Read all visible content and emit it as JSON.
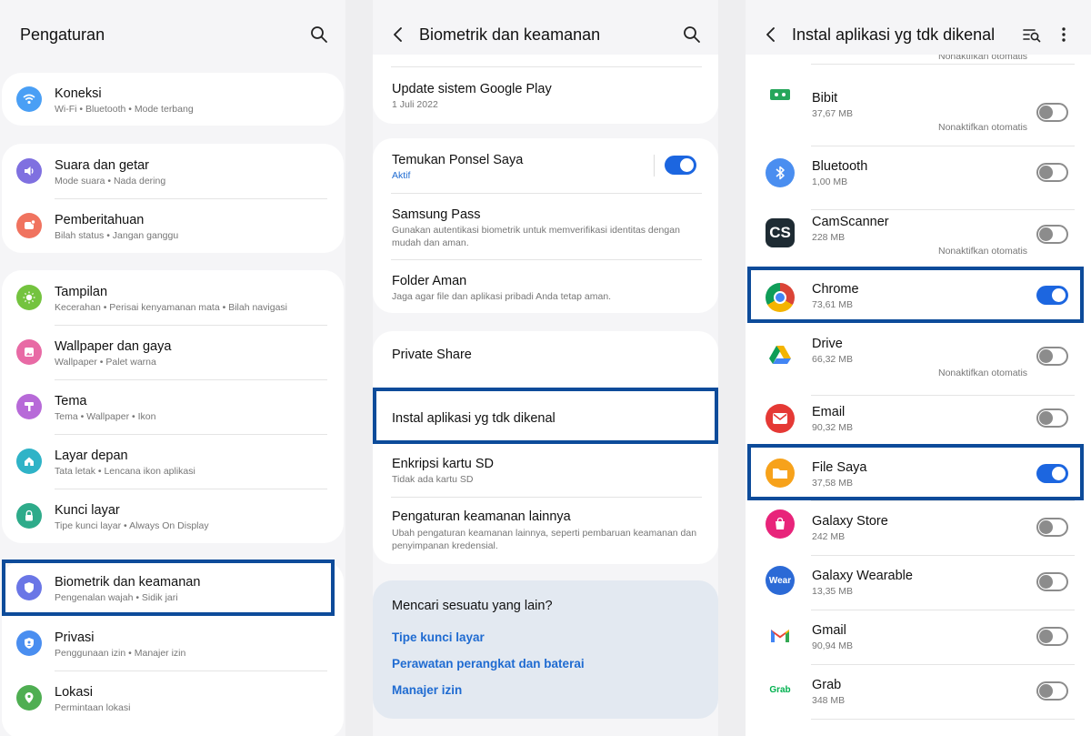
{
  "panel1": {
    "title": "Pengaturan",
    "search_icon": "search-icon",
    "items": [
      {
        "title": "Koneksi",
        "subtitle": "Wi-Fi  •  Bluetooth  •  Mode terbang",
        "icon": "wifi-icon",
        "color": "#4a9ff5"
      },
      {
        "title": "Suara dan getar",
        "subtitle": "Mode suara  •  Nada dering",
        "icon": "volume-icon",
        "color": "#7f70e0"
      },
      {
        "title": "Pemberitahuan",
        "subtitle": "Bilah status  •  Jangan ganggu",
        "icon": "notification-icon",
        "color": "#f0735f"
      },
      {
        "title": "Tampilan",
        "subtitle": "Kecerahan  •  Perisai kenyamanan mata  •  Bilah navigasi",
        "icon": "brightness-icon",
        "color": "#74c33f"
      },
      {
        "title": "Wallpaper dan gaya",
        "subtitle": "Wallpaper  •  Palet warna",
        "icon": "wallpaper-icon",
        "color": "#e86aa5"
      },
      {
        "title": "Tema",
        "subtitle": "Tema  •  Wallpaper  •  Ikon",
        "icon": "theme-icon",
        "color": "#b76ad8"
      },
      {
        "title": "Layar depan",
        "subtitle": "Tata letak  •  Lencana ikon aplikasi",
        "icon": "home-icon",
        "color": "#2fb3c7"
      },
      {
        "title": "Kunci layar",
        "subtitle": "Tipe kunci layar  •  Always On Display",
        "icon": "lock-icon",
        "color": "#2eab8a"
      },
      {
        "title": "Biometrik dan keamanan",
        "subtitle": "Pengenalan wajah  •  Sidik jari",
        "icon": "shield-icon",
        "color": "#6a76e6"
      },
      {
        "title": "Privasi",
        "subtitle": "Penggunaan izin  •  Manajer izin",
        "icon": "privacy-icon",
        "color": "#4a8ef0"
      },
      {
        "title": "Lokasi",
        "subtitle": "Permintaan lokasi",
        "icon": "location-icon",
        "color": "#4fae52"
      }
    ]
  },
  "panel2": {
    "title": "Biometrik dan keamanan",
    "items": [
      {
        "title": "Update sistem Google Play",
        "subtitle": "1 Juli 2022"
      },
      {
        "title": "Temukan Ponsel Saya",
        "subtitle": "Aktif",
        "toggle": "on"
      },
      {
        "title": "Samsung Pass",
        "subtitle": "Gunakan autentikasi biometrik untuk memverifikasi identitas dengan mudah dan aman."
      },
      {
        "title": "Folder Aman",
        "subtitle": "Jaga agar file dan aplikasi pribadi Anda tetap aman."
      },
      {
        "title": "Private Share"
      },
      {
        "title": "Instal aplikasi yg tdk dikenal"
      },
      {
        "title": "Enkripsi kartu SD",
        "subtitle": "Tidak ada kartu SD"
      },
      {
        "title": "Pengaturan keamanan lainnya",
        "subtitle": "Ubah pengaturan keamanan lainnya, seperti pembaruan keamanan dan penyimpanan kredensial."
      }
    ],
    "suggest": {
      "heading": "Mencari sesuatu yang lain?",
      "links": [
        "Tipe kunci layar",
        "Perawatan perangkat dan baterai",
        "Manajer izin"
      ]
    },
    "accent": "#1f6bd1"
  },
  "panel3": {
    "title": "Instal aplikasi yg tdk dikenal",
    "top_fragment": "Nonaktifkan otomatis",
    "apps": [
      {
        "name": "Bibit",
        "size": "37,67 MB",
        "note": "Nonaktifkan otomatis",
        "toggle": "off",
        "icon": "bibit-icon"
      },
      {
        "name": "Bluetooth",
        "size": "1,00 MB",
        "toggle": "off",
        "icon": "bluetooth-icon"
      },
      {
        "name": "CamScanner",
        "size": "228 MB",
        "note": "Nonaktifkan otomatis",
        "toggle": "off",
        "icon": "camscanner-icon",
        "icon_text": "CS"
      },
      {
        "name": "Chrome",
        "size": "73,61 MB",
        "toggle": "on",
        "icon": "chrome-icon"
      },
      {
        "name": "Drive",
        "size": "66,32 MB",
        "note": "Nonaktifkan otomatis",
        "toggle": "off",
        "icon": "drive-icon"
      },
      {
        "name": "Email",
        "size": "90,32 MB",
        "toggle": "off",
        "icon": "email-icon"
      },
      {
        "name": "File Saya",
        "size": "37,58 MB",
        "toggle": "on",
        "icon": "folder-icon"
      },
      {
        "name": "Galaxy Store",
        "size": "242 MB",
        "toggle": "off",
        "icon": "galaxy-store-icon"
      },
      {
        "name": "Galaxy Wearable",
        "size": "13,35 MB",
        "toggle": "off",
        "icon": "wear-icon",
        "icon_text": "Wear"
      },
      {
        "name": "Gmail",
        "size": "90,94 MB",
        "toggle": "off",
        "icon": "gmail-icon"
      },
      {
        "name": "Grab",
        "size": "348 MB",
        "toggle": "off",
        "icon": "grab-icon",
        "icon_text": "Grab"
      }
    ],
    "toggle_on_color": "#1c66e0",
    "toggle_off_color": "#8c8c8c"
  },
  "highlight_color": "#0d4b9a"
}
